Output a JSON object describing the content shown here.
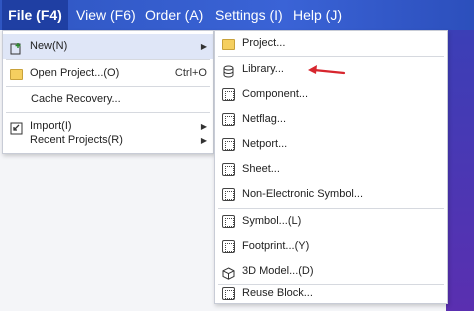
{
  "menubar": {
    "file": "File (F4)",
    "view": "View (F6)",
    "order": "Order (A)",
    "settings": "Settings (I)",
    "help": "Help (J)"
  },
  "file_menu": {
    "new": "New(N)",
    "open_project": "Open Project...(O)",
    "open_shortcut": "Ctrl+O",
    "cache_recovery": "Cache Recovery...",
    "import": "Import(I)",
    "recent_projects": "Recent Projects(R)"
  },
  "new_submenu": {
    "project": "Project...",
    "library": "Library...",
    "component": "Component...",
    "netflag": "Netflag...",
    "netport": "Netport...",
    "sheet": "Sheet...",
    "non_electronic_symbol": "Non-Electronic Symbol...",
    "symbol": "Symbol...(L)",
    "footprint": "Footprint...(Y)",
    "model_3d": "3D Model...(D)",
    "reuse_block": "Reuse Block..."
  },
  "colors": {
    "menubar": "#3a63d6",
    "highlight": "#dfe6f7",
    "annotation_arrow": "#d7262e"
  }
}
